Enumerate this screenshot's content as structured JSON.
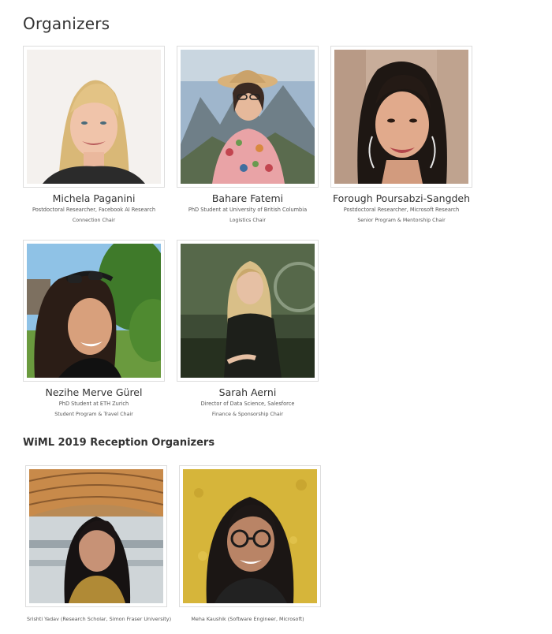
{
  "page": {
    "title": "Organizers",
    "reception_title": "WiML 2019 Reception Organizers"
  },
  "organizers": [
    {
      "name": "Michela Paganini",
      "role": "Postdoctoral Researcher, Facebook AI Research",
      "chair": "Connection Chair",
      "photo": "woman-blonde-portrait-photo"
    },
    {
      "name": "Bahare Fatemi",
      "role": "PhD Student at University of British Columbia",
      "chair": "Logistics Chair",
      "photo": "woman-sunhat-mountains-photo"
    },
    {
      "name": "Forough Poursabzi-Sangdeh",
      "role": "Postdoctoral Researcher, Microsoft Research",
      "chair": "Senior Program & Mentorship Chair",
      "photo": "woman-dark-hair-earrings-photo"
    },
    {
      "name": "Nezihe Merve Gürel",
      "role": "PhD Student at ETH Zurich",
      "chair": "Student Program & Travel Chair",
      "photo": "woman-sunglasses-outdoor-selfie-photo"
    },
    {
      "name": "Sarah Aerni",
      "role": "Director of Data Science, Salesforce",
      "chair": "Finance & Sponsorship Chair",
      "photo": "woman-speaking-stage-photo"
    }
  ],
  "reception_organizers": [
    {
      "caption": "Srishti Yadav (Research Scholar, Simon Fraser University)",
      "photo": "woman-atrium-photo"
    },
    {
      "caption": "Meha Kaushik (Software Engineer, Microsoft)",
      "photo": "woman-glasses-yellow-wall-photo"
    }
  ]
}
